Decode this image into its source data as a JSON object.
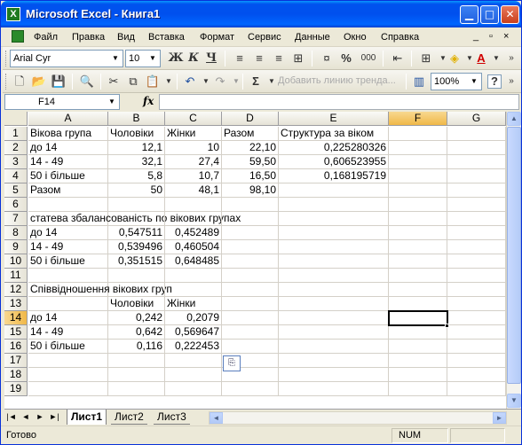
{
  "window": {
    "title": "Microsoft Excel - Книга1",
    "app_icon": "excel-icon",
    "controls": [
      "minimize-icon",
      "maximize-icon",
      "close-icon"
    ]
  },
  "menu": {
    "items": [
      "Файл",
      "Правка",
      "Вид",
      "Вставка",
      "Формат",
      "Сервис",
      "Данные",
      "Окно",
      "Справка"
    ],
    "right": [
      "_",
      "×"
    ]
  },
  "toolbar_format": {
    "font_name": "Arial Cyr",
    "font_size": "10",
    "bold": "Ж",
    "italic": "К",
    "underline": "Ч",
    "percent": "%",
    "thousands": "000"
  },
  "toolbar_standard": {
    "sum": "Σ",
    "add_trendline": "Добавить линию тренда...",
    "zoom": "100%",
    "help": "?"
  },
  "formula_bar": {
    "name_box": "F14",
    "fx": "fx",
    "content": ""
  },
  "grid": {
    "columns": [
      "A",
      "B",
      "C",
      "D",
      "E",
      "F",
      "G"
    ],
    "active_column": "F",
    "active_row": 14,
    "rows": [
      {
        "n": "1",
        "A": "Вікова група",
        "B": "Чоловіки",
        "C": "Жінки",
        "D": "Разом",
        "E": "Структура за віком"
      },
      {
        "n": "2",
        "A": "до 14",
        "B": "12,1",
        "C": "10",
        "D": "22,10",
        "E": "0,225280326"
      },
      {
        "n": "3",
        "A": "14 - 49",
        "B": "32,1",
        "C": "27,4",
        "D": "59,50",
        "E": "0,606523955"
      },
      {
        "n": "4",
        "A": "50 і більше",
        "B": "5,8",
        "C": "10,7",
        "D": "16,50",
        "E": "0,168195719"
      },
      {
        "n": "5",
        "A": "Разом",
        "B": "50",
        "C": "48,1",
        "D": "98,10",
        "E": ""
      },
      {
        "n": "6",
        "A": "",
        "B": "",
        "C": "",
        "D": "",
        "E": ""
      },
      {
        "n": "7",
        "A": "статева збалансованість по вікових групах",
        "B": "",
        "C": "",
        "D": "",
        "E": ""
      },
      {
        "n": "8",
        "A": "до 14",
        "B": "0,547511",
        "C": "0,452489",
        "D": "",
        "E": ""
      },
      {
        "n": "9",
        "A": "14 - 49",
        "B": "0,539496",
        "C": "0,460504",
        "D": "",
        "E": ""
      },
      {
        "n": "10",
        "A": "50 і більше",
        "B": "0,351515",
        "C": "0,648485",
        "D": "",
        "E": ""
      },
      {
        "n": "11",
        "A": "",
        "B": "",
        "C": "",
        "D": "",
        "E": ""
      },
      {
        "n": "12",
        "A": "Співвідношення вікових груп",
        "B": "",
        "C": "",
        "D": "",
        "E": ""
      },
      {
        "n": "13",
        "A": "",
        "B": "Чоловіки",
        "C": "Жінки",
        "D": "",
        "E": ""
      },
      {
        "n": "14",
        "A": "до 14",
        "B": "0,242",
        "C": "0,2079",
        "D": "",
        "E": ""
      },
      {
        "n": "15",
        "A": "14 - 49",
        "B": "0,642",
        "C": "0,569647",
        "D": "",
        "E": ""
      },
      {
        "n": "16",
        "A": "50 і більше",
        "B": "0,116",
        "C": "0,222453",
        "D": "",
        "E": ""
      },
      {
        "n": "17",
        "A": "",
        "B": "",
        "C": "",
        "D": "",
        "E": ""
      },
      {
        "n": "18",
        "A": "",
        "B": "",
        "C": "",
        "D": "",
        "E": ""
      },
      {
        "n": "19",
        "A": "",
        "B": "",
        "C": "",
        "D": "",
        "E": ""
      }
    ]
  },
  "sheets": {
    "tabs": [
      "Лист1",
      "Лист2",
      "Лист3"
    ],
    "active": "Лист1"
  },
  "status": {
    "text": "Готово",
    "num": "NUM"
  }
}
